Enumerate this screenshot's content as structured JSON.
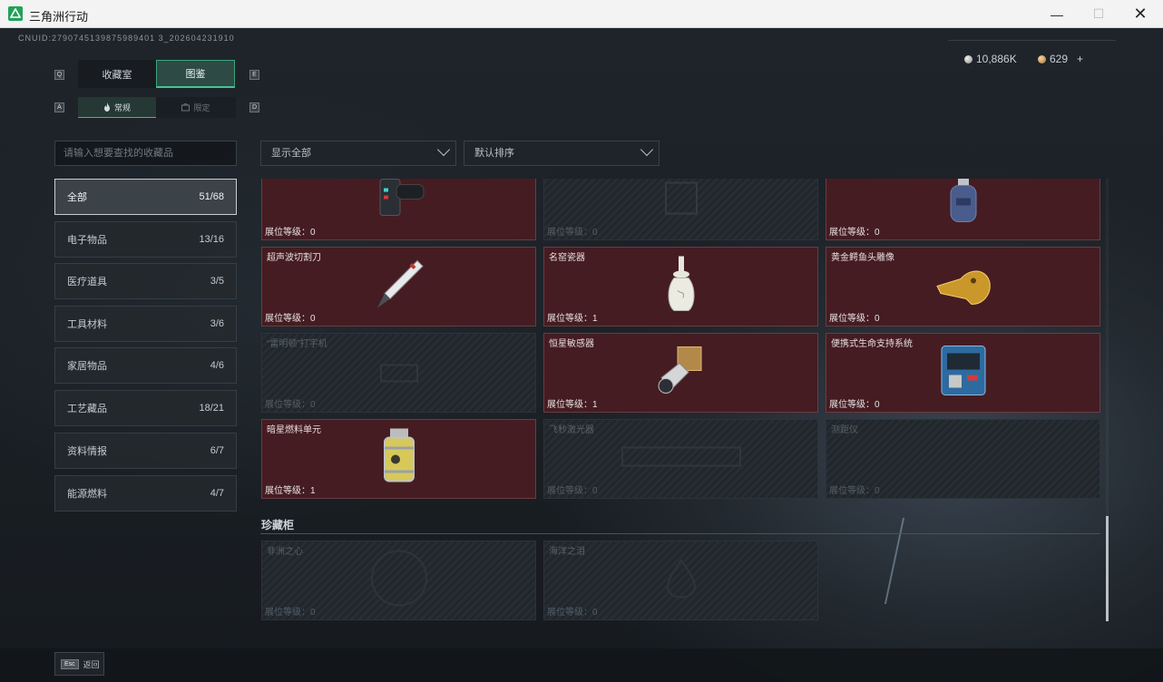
{
  "window": {
    "title": "三角洲行动",
    "min_glyph": "—",
    "max_glyph": "☐",
    "close_glyph": "✕"
  },
  "header": {
    "uid": "CNUID:2790745139875989401 3_202604231910",
    "currency_a": "10,886K",
    "currency_b": "629",
    "plus": "+"
  },
  "tabs": {
    "key_left": "Q",
    "key_right": "E",
    "items": [
      {
        "label": "收藏室"
      },
      {
        "label": "图鉴"
      }
    ]
  },
  "subtabs": {
    "key_left": "A",
    "key_right": "D",
    "items": [
      {
        "label": "常规",
        "icon": "flame-icon"
      },
      {
        "label": "限定",
        "icon": "medal-icon"
      }
    ]
  },
  "search": {
    "placeholder": "请输入想要查找的收藏品"
  },
  "filters": {
    "show": "显示全部",
    "sort": "默认排序"
  },
  "categories": [
    {
      "label": "全部",
      "count": "51/68"
    },
    {
      "label": "电子物品",
      "count": "13/16"
    },
    {
      "label": "医疗道具",
      "count": "3/5"
    },
    {
      "label": "工具材料",
      "count": "3/6"
    },
    {
      "label": "家居物品",
      "count": "4/6"
    },
    {
      "label": "工艺藏品",
      "count": "18/21"
    },
    {
      "label": "资料情报",
      "count": "6/7"
    },
    {
      "label": "能源燃料",
      "count": "4/7"
    }
  ],
  "level_label": "展位等级：",
  "items": [
    {
      "name": "",
      "level": "0",
      "unlocked": true,
      "icon": "device-icon"
    },
    {
      "name": "",
      "level": "0",
      "unlocked": false,
      "icon": "box-icon"
    },
    {
      "name": "",
      "level": "0",
      "unlocked": true,
      "icon": "gas-canister-icon"
    },
    {
      "name": "超声波切割刀",
      "level": "0",
      "unlocked": true,
      "icon": "scalpel-icon"
    },
    {
      "name": "名窑瓷器",
      "level": "1",
      "unlocked": true,
      "icon": "vase-icon"
    },
    {
      "name": "黄金鳄鱼头雕像",
      "level": "0",
      "unlocked": true,
      "icon": "gold-croc-icon"
    },
    {
      "name": "“雷明顿”打字机",
      "level": "0",
      "unlocked": false,
      "icon": "typewriter-icon"
    },
    {
      "name": "恒星敏感器",
      "level": "1",
      "unlocked": true,
      "icon": "star-sensor-icon"
    },
    {
      "name": "便携式生命支持系统",
      "level": "0",
      "unlocked": true,
      "icon": "life-support-icon"
    },
    {
      "name": "暗星燃料单元",
      "level": "1",
      "unlocked": true,
      "icon": "fuel-cell-icon"
    },
    {
      "name": "飞秒激光器",
      "level": "0",
      "unlocked": false,
      "icon": "laser-icon"
    },
    {
      "name": "测距仪",
      "level": "0",
      "unlocked": false,
      "icon": "rangefinder-icon"
    }
  ],
  "section": {
    "title": "珍藏柜"
  },
  "treasures": [
    {
      "name": "非洲之心",
      "level": "0",
      "unlocked": false,
      "icon": "gem-icon"
    },
    {
      "name": "海洋之泪",
      "level": "0",
      "unlocked": false,
      "icon": "tear-gem-icon"
    }
  ],
  "footer": {
    "esc_key": "Esc",
    "back_label": "返回"
  },
  "colors": {
    "accent": "#44c48f",
    "card_unlocked": "#451c22",
    "card_border": "#6a3c40"
  }
}
